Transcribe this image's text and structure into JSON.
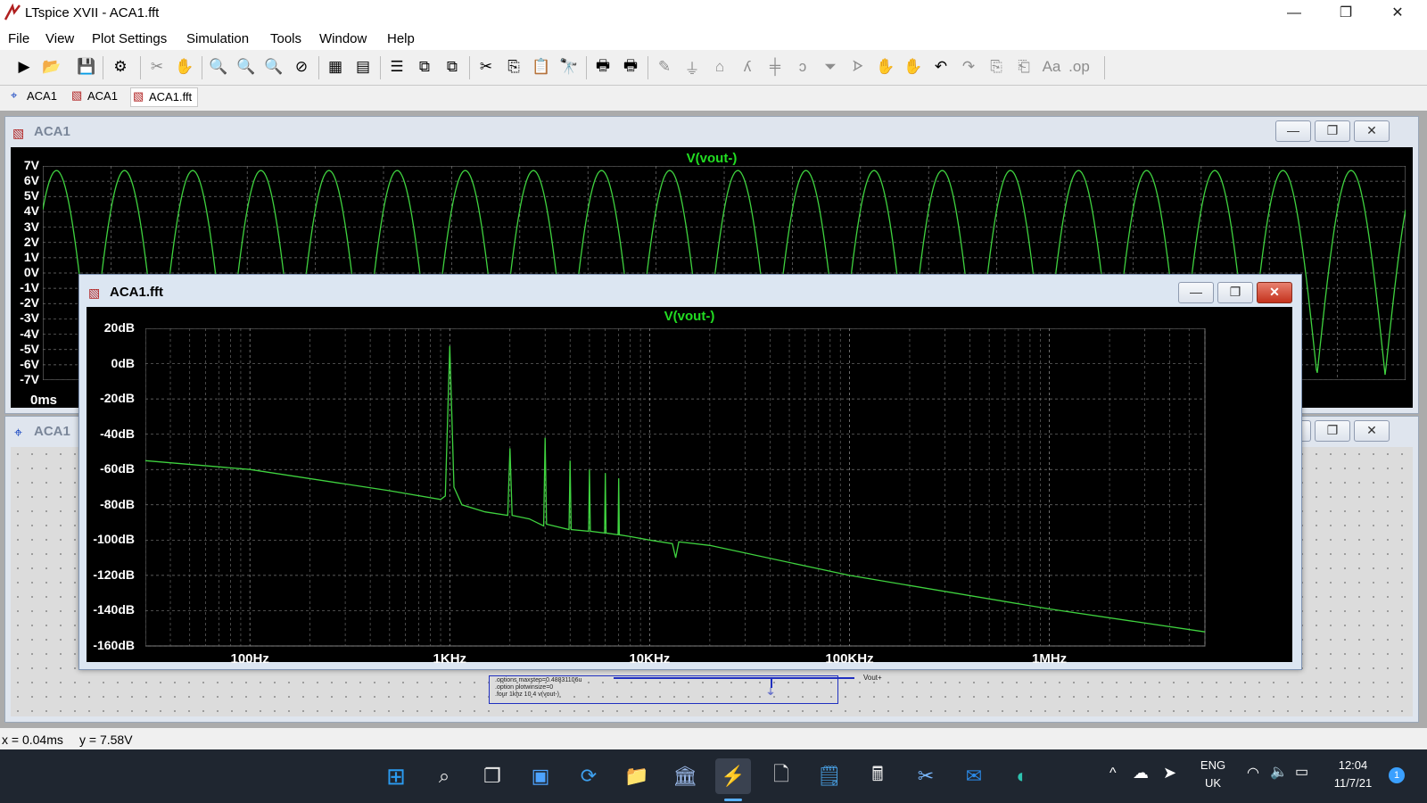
{
  "window": {
    "title": "LTspice XVII - ACA1.fft",
    "minimize": "—",
    "maximize": "❐",
    "close": "✕"
  },
  "menu": [
    "File",
    "View",
    "Plot Settings",
    "Simulation",
    "Tools",
    "Window",
    "Help"
  ],
  "toolbar_icons": [
    "run-icon",
    "open-icon",
    "save-icon",
    "control-panel-icon",
    "halt-icon",
    "pan-icon",
    "zoom-in-icon",
    "zoom-out-icon",
    "zoom-full-icon",
    "zoom-cancel-icon",
    "autorange-icon",
    "grid-icon",
    "tile-horizontal-icon",
    "tile-vertical-icon",
    "cascade-icon",
    "cut-icon",
    "copy-icon",
    "paste-icon",
    "find-icon",
    "print-icon",
    "print-setup-icon",
    "wire-icon",
    "ground-icon",
    "label-icon",
    "resistor-icon",
    "capacitor-icon",
    "inductor-icon",
    "diode-icon",
    "component-icon",
    "move-icon",
    "drag-icon",
    "undo-icon",
    "redo-icon",
    "rotate-icon",
    "mirror-icon",
    "text-icon",
    "spice-directive-icon"
  ],
  "tabs": [
    {
      "label": "ACA1",
      "icon": "schematic-icon"
    },
    {
      "label": "ACA1",
      "icon": "waveform-icon"
    },
    {
      "label": "ACA1.fft",
      "icon": "fft-icon"
    }
  ],
  "time_window": {
    "title": "ACA1",
    "trace": "V(vout-)",
    "y_labels": [
      "7V",
      "6V",
      "5V",
      "4V",
      "3V",
      "2V",
      "1V",
      "0V",
      "-1V",
      "-2V",
      "-3V",
      "-4V",
      "-5V",
      "-6V",
      "-7V"
    ],
    "x_label": "0ms"
  },
  "schematic_window": {
    "title": "ACA1",
    "directives": [
      ".options maxstep=0.48831106u",
      ".option plotwinsize=0",
      ".four 1khz 10 4 v(vout-)"
    ],
    "net_label": "Vout+"
  },
  "fft_window": {
    "title": "ACA1.fft",
    "trace": "V(vout-)",
    "y_labels": [
      "20dB",
      "0dB",
      "-20dB",
      "-40dB",
      "-60dB",
      "-80dB",
      "-100dB",
      "-120dB",
      "-140dB",
      "-160dB"
    ],
    "x_labels": [
      "100Hz",
      "1KHz",
      "10KHz",
      "100KHz",
      "1MHz"
    ]
  },
  "status": {
    "x": "x = 0.04ms",
    "y": "y = 7.58V"
  },
  "taskbar": {
    "apps": [
      "windows-start-icon",
      "search-icon",
      "task-view-icon",
      "widgets-icon",
      "edge-sync-icon",
      "file-explorer-icon",
      "bank-icon",
      "ltspice-icon",
      "notepad-icon",
      "notes-icon",
      "calculator-icon",
      "snipping-tool-icon",
      "mail-icon",
      "edge-icon"
    ],
    "lang_top": "ENG",
    "lang_bottom": "UK",
    "time": "12:04",
    "date": "11/7/21",
    "notifications": "1"
  },
  "chart_data": [
    {
      "type": "line",
      "title": "V(vout-)",
      "xlabel": "",
      "ylabel": "",
      "ylim": [
        -7,
        7
      ],
      "x_tick_labels": [
        "0ms"
      ],
      "y_tick_labels": [
        "7V",
        "6V",
        "5V",
        "4V",
        "3V",
        "2V",
        "1V",
        "0V",
        "-1V",
        "-2V",
        "-3V",
        "-4V",
        "-5V",
        "-6V",
        "-7V"
      ],
      "series": [
        {
          "name": "V(vout-)",
          "shape": "full-wave-rectified-sine",
          "peak": 6.7,
          "trough": -6.7,
          "visible_cycles": 20
        }
      ],
      "grid": true
    },
    {
      "type": "line",
      "title": "V(vout-)",
      "xlabel": "",
      "ylabel": "",
      "x_scale": "log",
      "xlim": [
        30,
        6000000
      ],
      "ylim": [
        -160,
        20
      ],
      "x_tick_labels": [
        "100Hz",
        "1KHz",
        "10KHz",
        "100KHz",
        "1MHz"
      ],
      "y_tick_labels": [
        "20dB",
        "0dB",
        "-20dB",
        "-40dB",
        "-60dB",
        "-80dB",
        "-100dB",
        "-120dB",
        "-140dB",
        "-160dB"
      ],
      "series": [
        {
          "name": "V(vout-)",
          "color": "#3fd23f",
          "x": [
            30,
            100,
            500,
            900,
            950,
            1000,
            1050,
            1150,
            1500,
            1950,
            2000,
            2050,
            2500,
            2950,
            3000,
            3050,
            3950,
            4000,
            4050,
            4950,
            5000,
            5050,
            5950,
            6000,
            6050,
            6950,
            7000,
            7050,
            8000,
            10000,
            13000,
            13500,
            14000,
            20000,
            100000,
            1000000,
            6000000
          ],
          "y": [
            -55,
            -60,
            -72,
            -77,
            -75,
            10,
            -70,
            -80,
            -84,
            -86,
            -48,
            -86,
            -88,
            -92,
            -42,
            -91,
            -94,
            -55,
            -94,
            -95,
            -60,
            -95,
            -96,
            -62,
            -96,
            -97,
            -65,
            -97,
            -98,
            -100,
            -102,
            -110,
            -101,
            -103,
            -120,
            -139,
            -152
          ]
        }
      ],
      "grid": true
    }
  ]
}
